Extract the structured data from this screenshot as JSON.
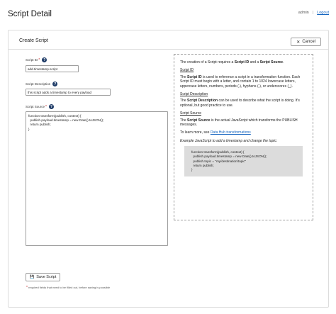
{
  "header": {
    "title": "Script Detail",
    "user": "admin",
    "separator": "|",
    "logout_label": "Logout"
  },
  "card": {
    "title": "Create Script",
    "cancel_label": "Cancel"
  },
  "form": {
    "id_label": "Script ID",
    "id_required_mark": "*",
    "id_value": "add-timestamp-script",
    "description_label": "Script Description",
    "description_value": "this script adds a timestamp to every payload",
    "source_label": "Script Source",
    "source_required_mark": "*",
    "source_value": "function transform(publish, context) {\n  publish.payload.timestamp = new Date().toJSON();\n  return publish;\n}",
    "save_label": "Save Script",
    "footnote_mark": "*",
    "footnote_text": "required fields that need to be filled out, before saving is possible"
  },
  "info": {
    "intro_pre": "The creation of a Script requires a ",
    "intro_b1": "Script ID",
    "intro_mid": " and a ",
    "intro_b2": "Script Source",
    "intro_end": ".",
    "id_heading": "Script ID",
    "id_pre": "The ",
    "id_b": "Script ID",
    "id_text": " is used to reference a script in a transformation function. Each Script ID must begin with a letter, and contain 1 to 1024 lowercase letters, uppercase letters, numbers, periods (.), hyphens (-), or underscores (_).",
    "desc_heading": "Script Description",
    "desc_pre": "The ",
    "desc_b": "Script Description",
    "desc_text": " can be used to describe what the script is doing. It's optional, but good practice to use.",
    "source_heading": "Script Source",
    "source_pre": "The ",
    "source_b": "Script Source",
    "source_text": " is the actual JavaScript which transforms the PUBLISH messages.",
    "learn_pre": "To learn more, see ",
    "learn_link": "Data Hub transformations",
    "example_caption": "Example JavaScript to add a timestamp and change the topic:",
    "example_code": "function transform(publish, context) {\n  publish.payload.timestamp = new Date().toJSON();\n  publish.topic = \"my/destination/topic\"\n  return publish;\n}"
  },
  "icons": {
    "help": "?",
    "cancel": "✕",
    "save": "💾"
  },
  "colors": {
    "help_icon": "#1f3c68",
    "link": "#1565c0",
    "required": "#c62828"
  }
}
